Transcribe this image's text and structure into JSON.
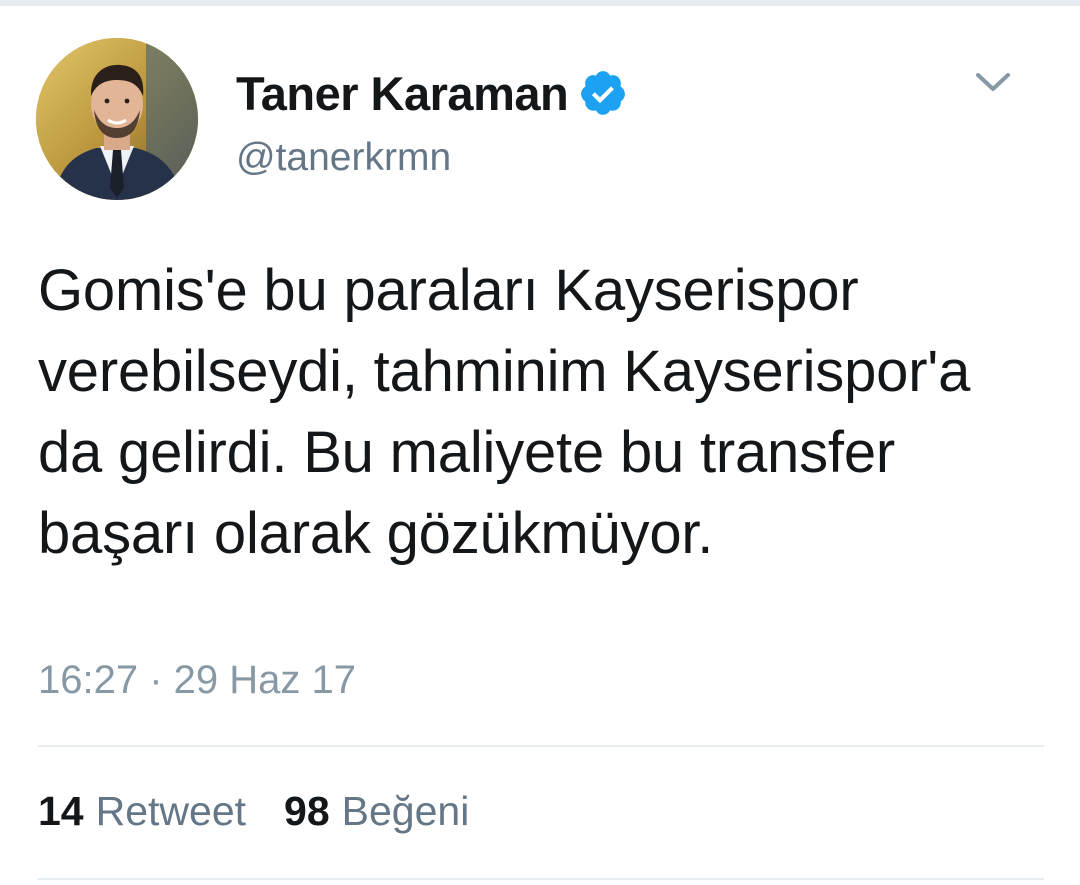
{
  "tweet": {
    "author": {
      "display_name": "Taner Karaman",
      "handle": "@tanerkrmn",
      "verified": true,
      "avatar_icon": "profile-photo"
    },
    "menu_icon": "chevron-down-icon",
    "text": "Gomis'e bu paraları Kayserispor verebilseydi, tahminim Kayserispor'a da gelirdi. Bu maliyete bu transfer başarı olarak gözükmüyor.",
    "timestamp": "16:27 · 29 Haz 17",
    "stats": {
      "retweets": {
        "count": "14",
        "label": "Retweet"
      },
      "likes": {
        "count": "98",
        "label": "Beğeni"
      }
    }
  },
  "colors": {
    "primary_text": "#14171a",
    "secondary_text": "#657786",
    "timestamp_text": "#8899a6",
    "verified_blue": "#1da1f2",
    "divider": "#e6ecf0"
  }
}
